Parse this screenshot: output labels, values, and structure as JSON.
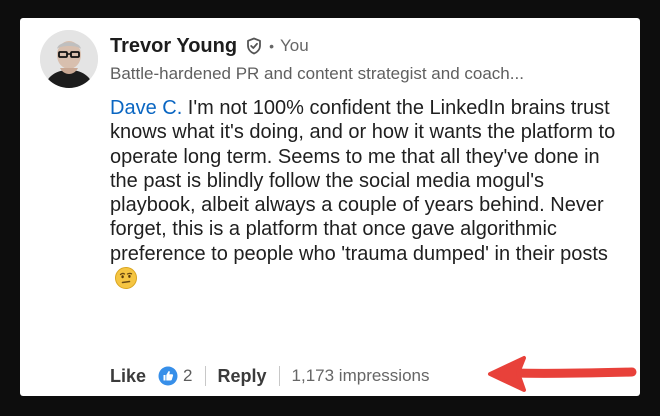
{
  "comment": {
    "author": {
      "name": "Trevor Young",
      "relation": "You",
      "headline": "Battle-hardened PR and content strategist and coach..."
    },
    "mention": "Dave C.",
    "body": " I'm not 100% confident the LinkedIn brains trust knows what it's doing, and or how it wants the platform to operate long term. Seems to me that all they've done in the past is blindly follow the social media mogul's playbook, albeit always a couple of years behind. Never forget, this is a platform that once gave algorithmic preference to people who 'trauma dumped' in their posts",
    "emoji": "thinking-face-emoji"
  },
  "actions": {
    "like_label": "Like",
    "reaction_count": "2",
    "reply_label": "Reply",
    "impressions": "1,173 impressions"
  },
  "colors": {
    "mention": "#0a66c2",
    "reaction": "#378fe9",
    "arrow": "#e8413a"
  }
}
